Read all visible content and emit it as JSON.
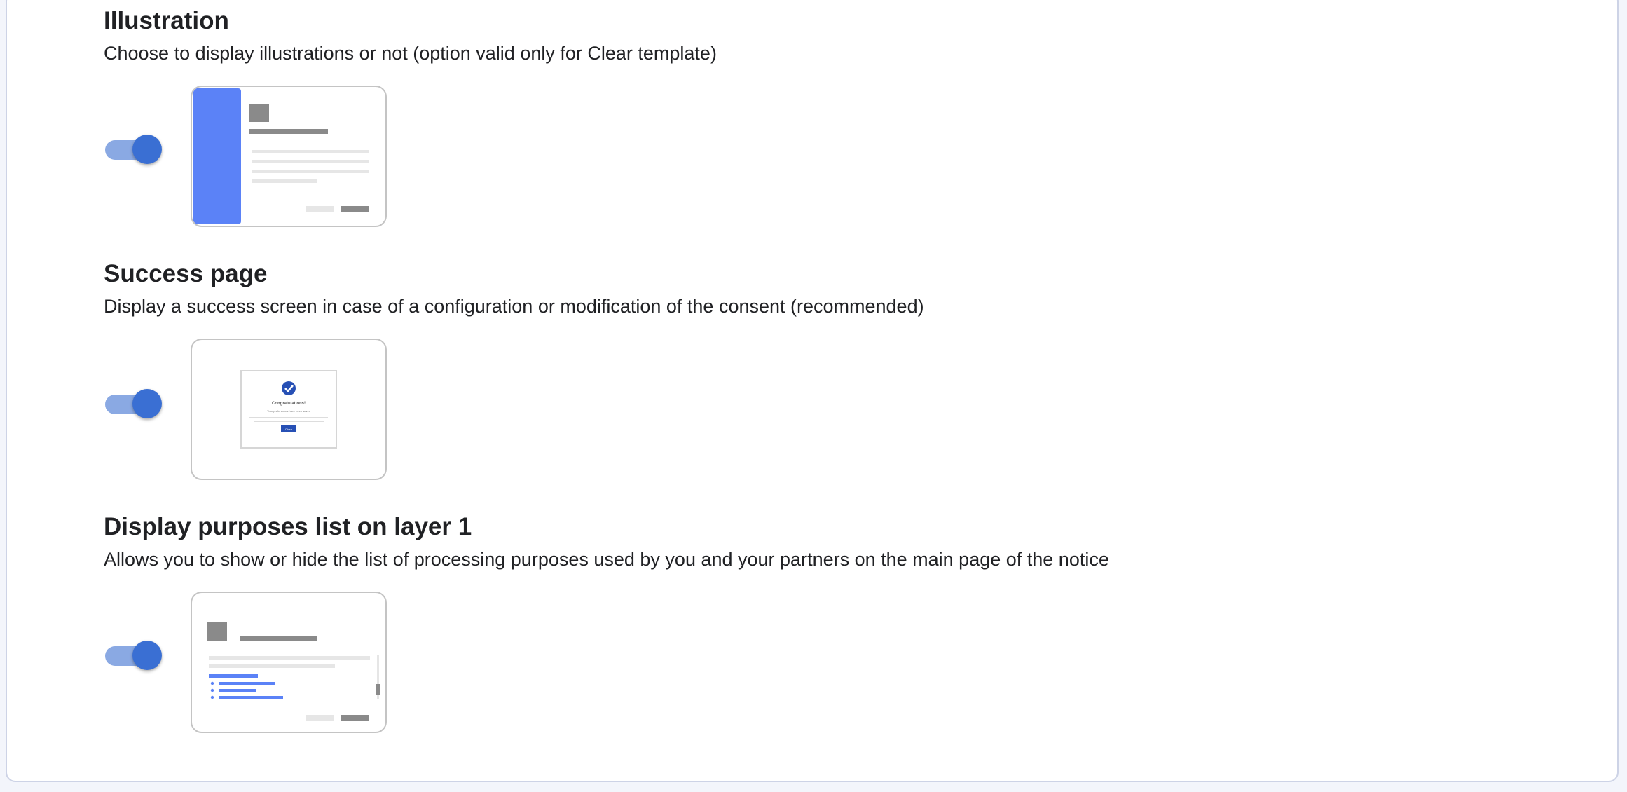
{
  "sections": [
    {
      "title": "Illustration",
      "description": "Choose to display illustrations or not (option valid only for Clear template)",
      "enabled": true,
      "preview_icon": "illustration-preview-icon"
    },
    {
      "title": "Success page",
      "description": "Display a success screen in case of a configuration or modification of the consent (recommended)",
      "enabled": true,
      "preview_icon": "success-page-preview-icon",
      "preview": {
        "heading": "Congratulations!",
        "subheading": "Your preferences have been saved",
        "button_label": "Close"
      }
    },
    {
      "title": "Display purposes list on layer 1",
      "description": "Allows you to show or hide the list of processing purposes used by you and your partners on the main page of the notice",
      "enabled": true,
      "preview_icon": "purposes-list-preview-icon"
    }
  ],
  "colors": {
    "accent": "#3a6fd3",
    "toggle_track": "#8aa9e3",
    "illustration_panel": "#5b82f7",
    "placeholder_dark": "#8a8a8a",
    "placeholder_light": "#e6e6e6",
    "success_check": "#2750b5"
  }
}
